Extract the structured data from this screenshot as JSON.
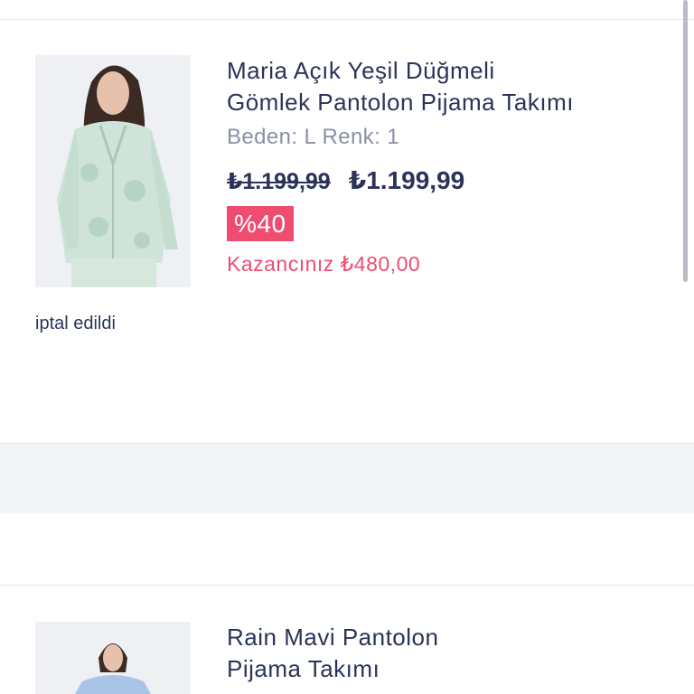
{
  "orders": [
    {
      "title_line1": "Maria Açık Yeşil Düğmeli",
      "title_line2": "Gömlek Pantolon Pijama Takımı",
      "attributes": "Beden: L Renk: 1",
      "old_price": "₺1.199,99",
      "new_price": "₺1.199,99",
      "discount": "%40",
      "saving": "Kazancınız ₺480,00",
      "status": "iptal edildi",
      "image_icon": "product-photo-green-pajama"
    },
    {
      "title_line1": "Rain Mavi Pantolon",
      "title_line2": "Pijama Takımı",
      "image_icon": "product-photo-blue-pajama"
    }
  ],
  "colors": {
    "text": "#2b3358",
    "muted": "#8a90a4",
    "accent_pink": "#ee4d71",
    "band": "#f3f4f6"
  }
}
